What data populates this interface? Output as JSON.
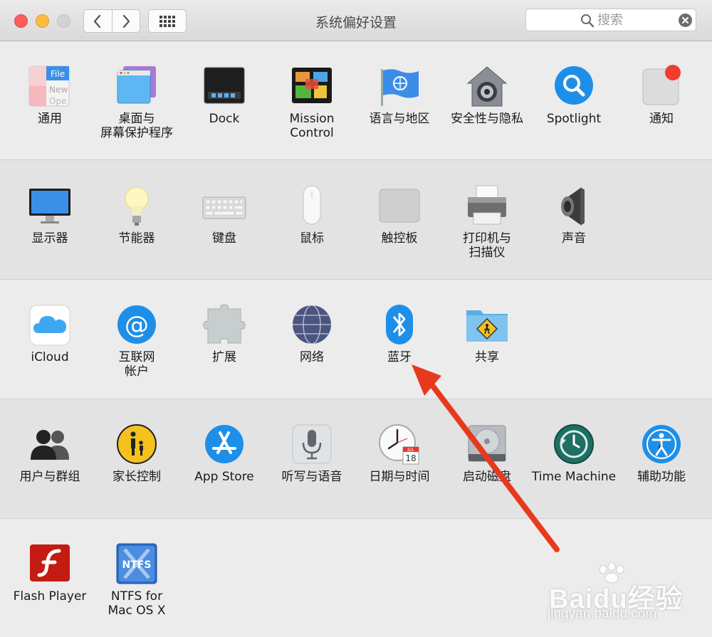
{
  "window": {
    "title": "系统偏好设置"
  },
  "search": {
    "placeholder": "搜索"
  },
  "sections": [
    {
      "panes": [
        {
          "name": "general",
          "label1": "通用",
          "label2": "",
          "icon": "general-icon"
        },
        {
          "name": "desktop-screensaver",
          "label1": "桌面与",
          "label2": "屏幕保护程序",
          "icon": "desktop-icon"
        },
        {
          "name": "dock",
          "label1": "Dock",
          "label2": "",
          "icon": "dock-icon"
        },
        {
          "name": "mission-control",
          "label1": "Mission",
          "label2": "Control",
          "icon": "mission-control-icon"
        },
        {
          "name": "language-region",
          "label1": "语言与地区",
          "label2": "",
          "icon": "flag-icon"
        },
        {
          "name": "security-privacy",
          "label1": "安全性与隐私",
          "label2": "",
          "icon": "security-house-icon"
        },
        {
          "name": "spotlight",
          "label1": "Spotlight",
          "label2": "",
          "icon": "spotlight-icon"
        },
        {
          "name": "notifications",
          "label1": "通知",
          "label2": "",
          "icon": "notifications-icon"
        }
      ]
    },
    {
      "panes": [
        {
          "name": "displays",
          "label1": "显示器",
          "label2": "",
          "icon": "display-icon"
        },
        {
          "name": "energy-saver",
          "label1": "节能器",
          "label2": "",
          "icon": "bulb-icon"
        },
        {
          "name": "keyboard",
          "label1": "键盘",
          "label2": "",
          "icon": "keyboard-icon"
        },
        {
          "name": "mouse",
          "label1": "鼠标",
          "label2": "",
          "icon": "mouse-icon"
        },
        {
          "name": "trackpad",
          "label1": "触控板",
          "label2": "",
          "icon": "trackpad-icon"
        },
        {
          "name": "printers-scanners",
          "label1": "打印机与",
          "label2": "扫描仪",
          "icon": "printer-icon"
        },
        {
          "name": "sound",
          "label1": "声音",
          "label2": "",
          "icon": "speaker-icon"
        }
      ]
    },
    {
      "panes": [
        {
          "name": "icloud",
          "label1": "iCloud",
          "label2": "",
          "icon": "cloud-icon"
        },
        {
          "name": "internet-accounts",
          "label1": "互联网",
          "label2": "帐户",
          "icon": "at-icon"
        },
        {
          "name": "extensions",
          "label1": "扩展",
          "label2": "",
          "icon": "puzzle-icon"
        },
        {
          "name": "network",
          "label1": "网络",
          "label2": "",
          "icon": "globe-icon"
        },
        {
          "name": "bluetooth",
          "label1": "蓝牙",
          "label2": "",
          "icon": "bluetooth-icon"
        },
        {
          "name": "sharing",
          "label1": "共享",
          "label2": "",
          "icon": "sharing-folder-icon"
        }
      ]
    },
    {
      "panes": [
        {
          "name": "users-groups",
          "label1": "用户与群组",
          "label2": "",
          "icon": "users-icon"
        },
        {
          "name": "parental-controls",
          "label1": "家长控制",
          "label2": "",
          "icon": "parental-icon"
        },
        {
          "name": "app-store",
          "label1": "App Store",
          "label2": "",
          "icon": "app-store-icon"
        },
        {
          "name": "dictation-speech",
          "label1": "听写与语音",
          "label2": "",
          "icon": "microphone-icon"
        },
        {
          "name": "date-time",
          "label1": "日期与时间",
          "label2": "",
          "icon": "clock-icon"
        },
        {
          "name": "startup-disk",
          "label1": "启动磁盘",
          "label2": "",
          "icon": "disk-icon"
        },
        {
          "name": "time-machine",
          "label1": "Time Machine",
          "label2": "",
          "icon": "time-machine-icon"
        },
        {
          "name": "accessibility",
          "label1": "辅助功能",
          "label2": "",
          "icon": "accessibility-icon"
        }
      ]
    },
    {
      "panes": [
        {
          "name": "flash-player",
          "label1": "Flash Player",
          "label2": "",
          "icon": "flash-icon"
        },
        {
          "name": "ntfs-for-mac",
          "label1": "NTFS for",
          "label2": "Mac OS X",
          "icon": "ntfs-icon"
        }
      ]
    }
  ],
  "icon_text": {
    "general": [
      "File",
      "New",
      "Ope"
    ],
    "calendar_month": "JUL",
    "calendar_day": "18",
    "ntfs": "NTFS"
  },
  "watermark": {
    "brand": "Baidu经验",
    "url": "jingyan.baidu.com"
  },
  "colors": {
    "annotation_arrow": "#e8391f",
    "accent_blue": "#1e8fe8"
  }
}
